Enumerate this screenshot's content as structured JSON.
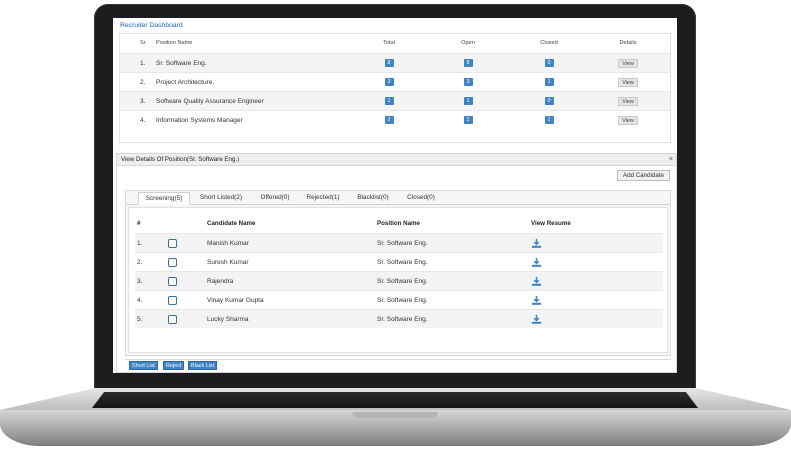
{
  "dashboard": {
    "title": "Recruiter Dashboard",
    "columns": {
      "sr": "Sr.",
      "position": "Position Name",
      "total": "Total",
      "open": "Open",
      "closed": "Closed",
      "details": "Details"
    },
    "rows": [
      {
        "sr": "1.",
        "position": "Sr. Software Eng.",
        "total": "8",
        "open": "8",
        "closed": "0",
        "details": "View"
      },
      {
        "sr": "2.",
        "position": "Project Architecture.",
        "total": "3",
        "open": "3",
        "closed": "1",
        "details": "View"
      },
      {
        "sr": "3.",
        "position": "Software Quality Assurance Engineer",
        "total": "1",
        "open": "1",
        "closed": "0",
        "details": "View"
      },
      {
        "sr": "4.",
        "position": "Information Systems Manager",
        "total": "2",
        "open": "1",
        "closed": "1",
        "details": "View"
      }
    ]
  },
  "detail": {
    "title": "View Details Of Position(Sr. Software Eng.)",
    "close": "×",
    "add_candidate": "Add Candidate",
    "tabs": [
      {
        "label": "Screening(5)",
        "active": true
      },
      {
        "label": "Short Listed(2)",
        "active": false
      },
      {
        "label": "Offered(0)",
        "active": false
      },
      {
        "label": "Rejected(1)",
        "active": false
      },
      {
        "label": "Blacklist(0)",
        "active": false
      },
      {
        "label": "Closed(0)",
        "active": false
      }
    ],
    "table": {
      "columns": {
        "num": "#",
        "name": "Candidate Name",
        "position": "Position Name",
        "resume": "View Resume"
      },
      "rows": [
        {
          "num": "1.",
          "name": "Manish Kumar",
          "position": "Sr. Software Eng."
        },
        {
          "num": "2.",
          "name": "Suresh Kumar",
          "position": "Sr. Software Eng."
        },
        {
          "num": "3.",
          "name": "Rajendra",
          "position": "Sr. Software Eng."
        },
        {
          "num": "4.",
          "name": "Vinay Kumar Gupta",
          "position": "Sr. Software Eng."
        },
        {
          "num": "5.",
          "name": "Lucky Sharma",
          "position": "Sr. Software Eng."
        }
      ]
    },
    "actions": {
      "short_list": "Short List",
      "reject": "Reject",
      "black_list": "Black List"
    }
  },
  "colors": {
    "accent": "#3c83c7",
    "link": "#1f5fd0",
    "bezel": "#1d1d1f"
  },
  "icons": {
    "resume": "download-icon",
    "close": "close-icon",
    "select": "checkbox"
  }
}
